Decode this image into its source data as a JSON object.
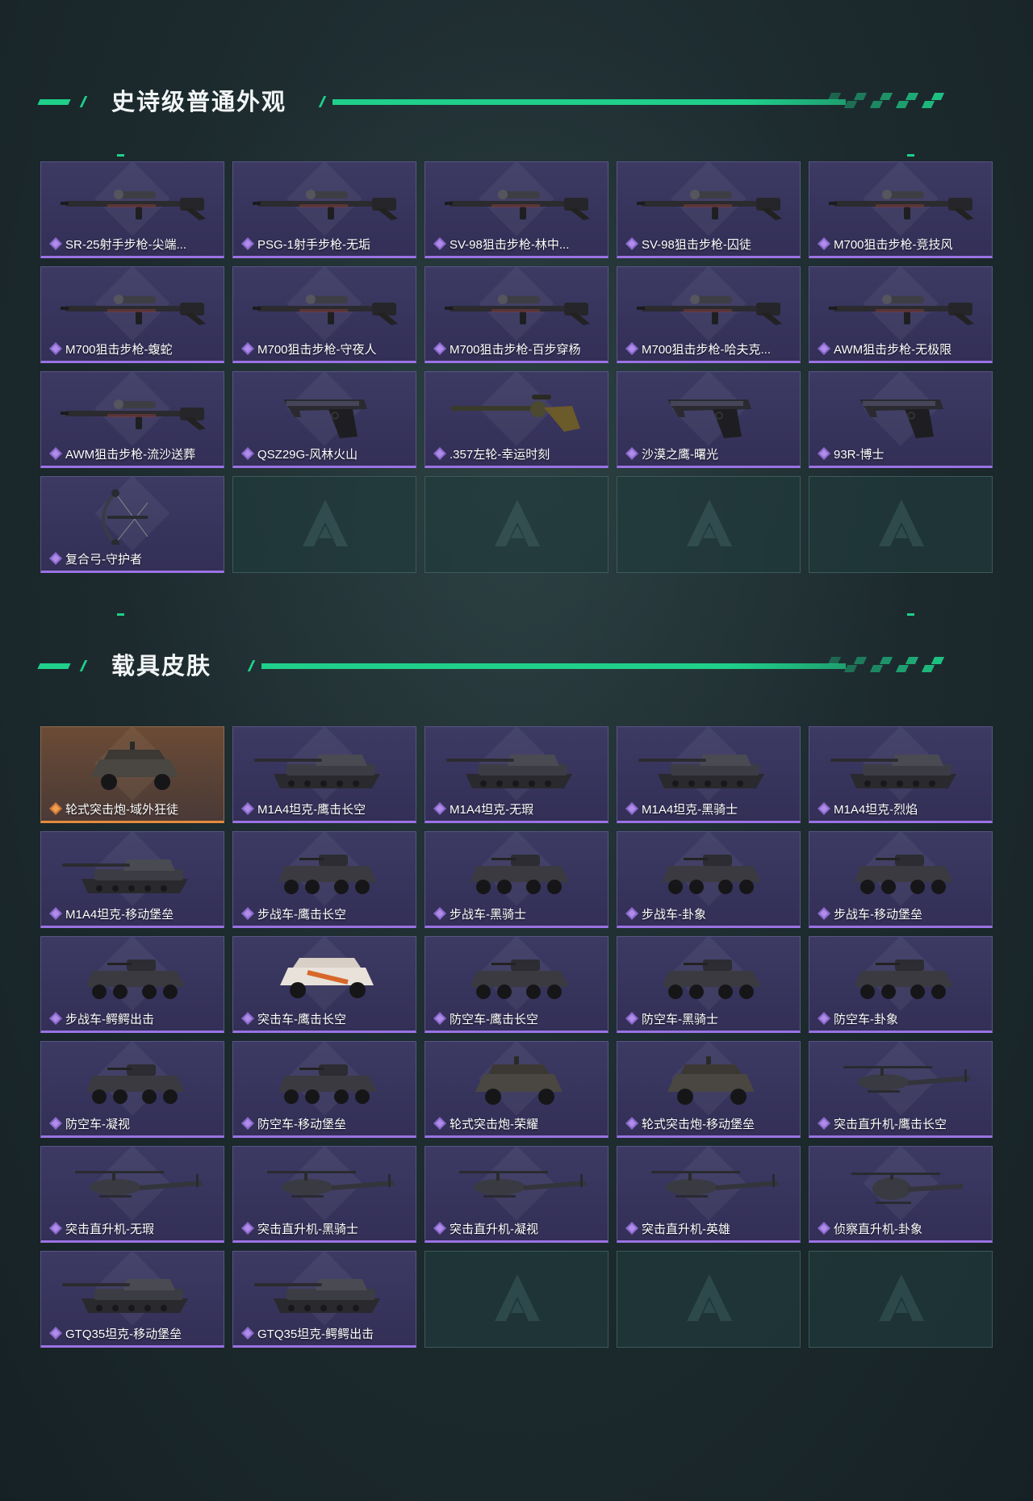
{
  "colors": {
    "accent_green": "#1fd08a",
    "card_purple": "#3a3760",
    "card_purple_border": "#9b72e3",
    "card_gold_border": "#e58a3c",
    "empty_slot": "#203a3c"
  },
  "sections": [
    {
      "title": "史诗级普通外观",
      "items": [
        {
          "name": "SR-25射手步枪-尖端...",
          "icon": "sniper-rifle-icon",
          "rarity": "purple"
        },
        {
          "name": "PSG-1射手步枪-无垢",
          "icon": "sniper-rifle-icon",
          "rarity": "purple"
        },
        {
          "name": "SV-98狙击步枪-林中...",
          "icon": "sniper-rifle-icon",
          "rarity": "purple"
        },
        {
          "name": "SV-98狙击步枪-囚徒",
          "icon": "sniper-rifle-icon",
          "rarity": "purple"
        },
        {
          "name": "M700狙击步枪-竞技风",
          "icon": "sniper-rifle-icon",
          "rarity": "purple"
        },
        {
          "name": "M700狙击步枪-蝮蛇",
          "icon": "sniper-rifle-icon",
          "rarity": "purple"
        },
        {
          "name": "M700狙击步枪-守夜人",
          "icon": "sniper-rifle-icon",
          "rarity": "purple"
        },
        {
          "name": "M700狙击步枪-百步穿杨",
          "icon": "sniper-rifle-icon",
          "rarity": "purple"
        },
        {
          "name": "M700狙击步枪-哈夫克...",
          "icon": "sniper-rifle-icon",
          "rarity": "purple"
        },
        {
          "name": "AWM狙击步枪-无极限",
          "icon": "sniper-rifle-icon",
          "rarity": "purple"
        },
        {
          "name": "AWM狙击步枪-流沙送葬",
          "icon": "sniper-rifle-icon",
          "rarity": "purple"
        },
        {
          "name": "QSZ29G-风林火山",
          "icon": "pistol-icon",
          "rarity": "purple"
        },
        {
          "name": ".357左轮-幸运时刻",
          "icon": "revolver-icon",
          "rarity": "purple"
        },
        {
          "name": "沙漠之鹰-曙光",
          "icon": "pistol-icon",
          "rarity": "purple"
        },
        {
          "name": "93R-博士",
          "icon": "pistol-icon",
          "rarity": "purple"
        },
        {
          "name": "复合弓-守护者",
          "icon": "compound-bow-icon",
          "rarity": "purple"
        }
      ],
      "empty_slots": 4
    },
    {
      "title": "载具皮肤",
      "items": [
        {
          "name": "轮式突击炮-域外狂徒",
          "icon": "armored-car-icon",
          "rarity": "gold"
        },
        {
          "name": "M1A4坦克-鹰击长空",
          "icon": "tank-icon",
          "rarity": "purple"
        },
        {
          "name": "M1A4坦克-无瑕",
          "icon": "tank-icon",
          "rarity": "purple"
        },
        {
          "name": "M1A4坦克-黑骑士",
          "icon": "tank-icon",
          "rarity": "purple"
        },
        {
          "name": "M1A4坦克-烈焰",
          "icon": "tank-icon",
          "rarity": "purple"
        },
        {
          "name": "M1A4坦克-移动堡垒",
          "icon": "tank-icon",
          "rarity": "purple"
        },
        {
          "name": "步战车-鹰击长空",
          "icon": "ifv-icon",
          "rarity": "purple"
        },
        {
          "name": "步战车-黑骑士",
          "icon": "ifv-icon",
          "rarity": "purple"
        },
        {
          "name": "步战车-卦象",
          "icon": "ifv-icon",
          "rarity": "purple"
        },
        {
          "name": "步战车-移动堡垒",
          "icon": "ifv-icon",
          "rarity": "purple"
        },
        {
          "name": "步战车-鳄鳄出击",
          "icon": "ifv-icon",
          "rarity": "purple"
        },
        {
          "name": "突击车-鹰击长空",
          "icon": "assault-vehicle-icon",
          "rarity": "purple"
        },
        {
          "name": "防空车-鹰击长空",
          "icon": "ifv-icon",
          "rarity": "purple"
        },
        {
          "name": "防空车-黑骑士",
          "icon": "ifv-icon",
          "rarity": "purple"
        },
        {
          "name": "防空车-卦象",
          "icon": "ifv-icon",
          "rarity": "purple"
        },
        {
          "name": "防空车-凝视",
          "icon": "ifv-icon",
          "rarity": "purple"
        },
        {
          "name": "防空车-移动堡垒",
          "icon": "ifv-icon",
          "rarity": "purple"
        },
        {
          "name": "轮式突击炮-荣耀",
          "icon": "armored-car-icon",
          "rarity": "purple"
        },
        {
          "name": "轮式突击炮-移动堡垒",
          "icon": "armored-car-icon",
          "rarity": "purple"
        },
        {
          "name": "突击直升机-鹰击长空",
          "icon": "helicopter-icon",
          "rarity": "purple"
        },
        {
          "name": "突击直升机-无瑕",
          "icon": "helicopter-icon",
          "rarity": "purple"
        },
        {
          "name": "突击直升机-黑骑士",
          "icon": "helicopter-icon",
          "rarity": "purple"
        },
        {
          "name": "突击直升机-凝视",
          "icon": "helicopter-icon",
          "rarity": "purple"
        },
        {
          "name": "突击直升机-英雄",
          "icon": "helicopter-icon",
          "rarity": "purple"
        },
        {
          "name": "侦察直升机-卦象",
          "icon": "scout-helicopter-icon",
          "rarity": "purple"
        },
        {
          "name": "GTQ35坦克-移动堡垒",
          "icon": "tank-icon",
          "rarity": "purple"
        },
        {
          "name": "GTQ35坦克-鳄鳄出击",
          "icon": "tank-icon",
          "rarity": "purple"
        }
      ],
      "empty_slots": 3
    }
  ]
}
